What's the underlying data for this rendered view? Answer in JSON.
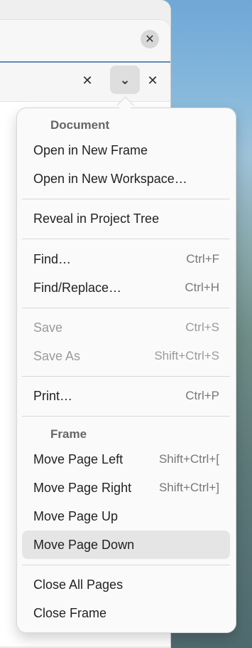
{
  "window": {
    "title_close_icon": "close-icon"
  },
  "tabs": {
    "left_close_icon": "close-icon",
    "dropdown_icon": "chevron-down-icon",
    "right_close_icon": "close-icon"
  },
  "menu": {
    "document_section": "Document",
    "items": [
      {
        "label": "Open in New Frame",
        "shortcut": "",
        "disabled": false
      },
      {
        "label": "Open in New Workspace…",
        "shortcut": "",
        "disabled": false
      },
      {
        "label": "Reveal in Project Tree",
        "shortcut": "",
        "disabled": false
      },
      {
        "label": "Find…",
        "shortcut": "Ctrl+F",
        "disabled": false
      },
      {
        "label": "Find/Replace…",
        "shortcut": "Ctrl+H",
        "disabled": false
      },
      {
        "label": "Save",
        "shortcut": "Ctrl+S",
        "disabled": true
      },
      {
        "label": "Save As",
        "shortcut": "Shift+Ctrl+S",
        "disabled": true
      },
      {
        "label": "Print…",
        "shortcut": "Ctrl+P",
        "disabled": false
      },
      {
        "label": "Move Page Left",
        "shortcut": "Shift+Ctrl+[",
        "disabled": false
      },
      {
        "label": "Move Page Right",
        "shortcut": "Shift+Ctrl+]",
        "disabled": false
      },
      {
        "label": "Move Page Up",
        "shortcut": "",
        "disabled": false
      },
      {
        "label": "Move Page Down",
        "shortcut": "",
        "disabled": false,
        "active": true
      },
      {
        "label": "Close All Pages",
        "shortcut": "",
        "disabled": false
      },
      {
        "label": "Close Frame",
        "shortcut": "",
        "disabled": false
      }
    ],
    "frame_section": "Frame"
  }
}
